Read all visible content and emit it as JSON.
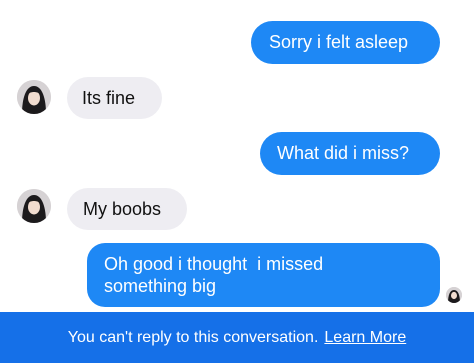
{
  "messages": [
    {
      "direction": "outgoing",
      "text": "Sorry i felt asleep"
    },
    {
      "direction": "incoming",
      "text": "Its fine",
      "avatar_icon": "user-avatar"
    },
    {
      "direction": "outgoing",
      "text": "What did i miss?"
    },
    {
      "direction": "incoming",
      "text": "My boobs",
      "avatar_icon": "user-avatar"
    },
    {
      "direction": "outgoing",
      "lines": [
        "Oh good i thought  i missed",
        "something big"
      ]
    }
  ],
  "read_receipt_icon": "seen-avatar",
  "footer": {
    "notice": "You can't reply to this conversation.",
    "link": "Learn More"
  },
  "colors": {
    "outgoing_bubble": "#1e88f5",
    "incoming_bubble": "#eeedf2",
    "footer_bar": "#1570e8",
    "background": "#ffffff"
  }
}
